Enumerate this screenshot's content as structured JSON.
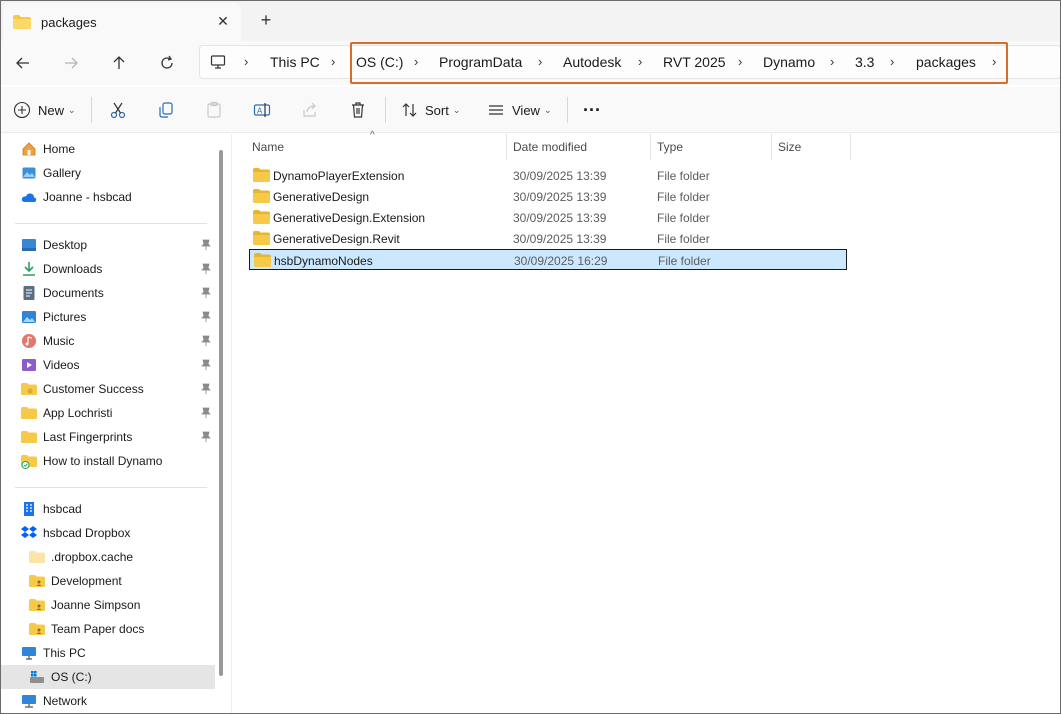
{
  "window": {
    "tab_title": "packages",
    "new_tab_label": "+",
    "close_label": "✕"
  },
  "breadcrumb": {
    "items": [
      "This PC",
      "OS (C:)",
      "ProgramData",
      "Autodesk",
      "RVT 2025",
      "Dynamo",
      "3.3",
      "packages"
    ]
  },
  "toolbar": {
    "new_label": "New",
    "sort_label": "Sort",
    "view_label": "View",
    "more_label": "···"
  },
  "columns": {
    "name": "Name",
    "date": "Date modified",
    "type": "Type",
    "size": "Size"
  },
  "files": [
    {
      "name": "DynamoPlayerExtension",
      "date": "30/09/2025 13:39",
      "type": "File folder"
    },
    {
      "name": "GenerativeDesign",
      "date": "30/09/2025 13:39",
      "type": "File folder"
    },
    {
      "name": "GenerativeDesign.Extension",
      "date": "30/09/2025 13:39",
      "type": "File folder"
    },
    {
      "name": "GenerativeDesign.Revit",
      "date": "30/09/2025 13:39",
      "type": "File folder"
    },
    {
      "name": "hsbDynamoNodes",
      "date": "30/09/2025 16:29",
      "type": "File folder",
      "selected": true
    }
  ],
  "sidebar": {
    "quick": [
      "Home",
      "Gallery",
      "Joanne - hsbcad"
    ],
    "pinned": [
      "Desktop",
      "Downloads",
      "Documents",
      "Pictures",
      "Music",
      "Videos",
      "Customer Success",
      "App Lochristi",
      "Last Fingerprints",
      "How to install Dynamo"
    ],
    "cloud": [
      "hsbcad",
      "hsbcad Dropbox",
      ".dropbox.cache",
      "Development",
      "Joanne Simpson",
      "Team Paper docs"
    ],
    "pc": [
      "This PC",
      "OS (C:)",
      "Network"
    ]
  },
  "colors": {
    "highlight_box": "#d96c2c",
    "folder_yellow": "#f7c948",
    "selection_bg": "#cce8ff"
  }
}
